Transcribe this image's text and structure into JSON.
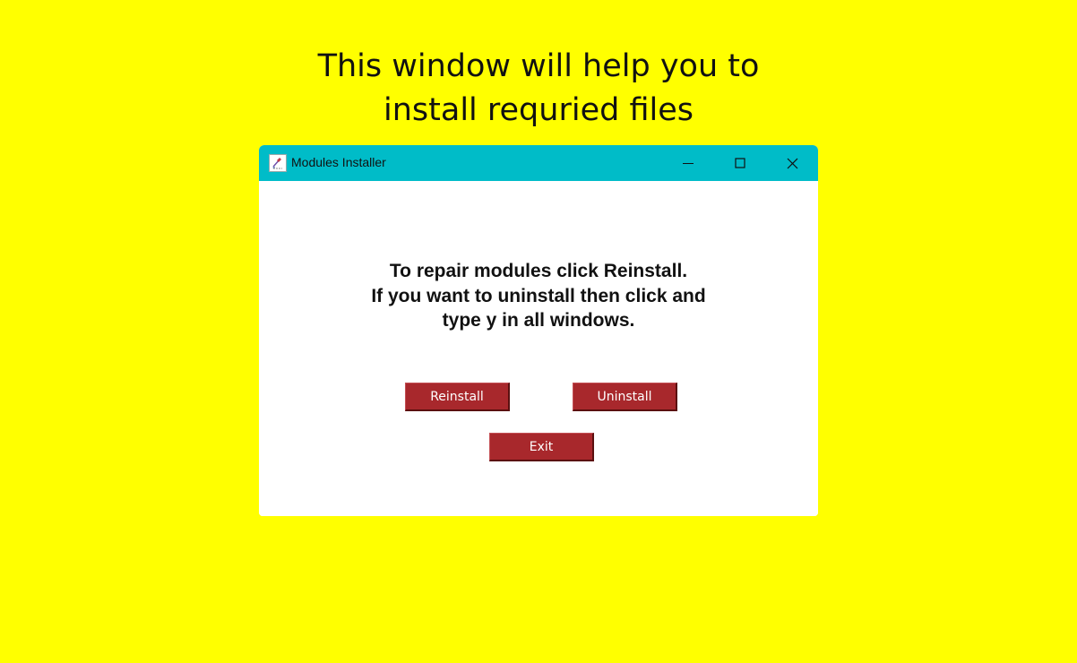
{
  "headline": {
    "line1": "This window will help you to",
    "line2": "install requried files"
  },
  "window": {
    "title": "Modules Installer",
    "app_icon": "feather-app-icon",
    "controls": {
      "minimize_icon": "minimize-icon",
      "maximize_icon": "maximize-icon",
      "close_icon": "close-icon"
    },
    "titlebar_color": "#00bcc8"
  },
  "message": {
    "line1": "To repair modules click Reinstall.",
    "line2": "If you want to uninstall then click and",
    "line3": "type y in all windows."
  },
  "buttons": {
    "reinstall": "Reinstall",
    "uninstall": "Uninstall",
    "exit": "Exit",
    "color": "#a8282c"
  },
  "background_color": "#ffff00"
}
